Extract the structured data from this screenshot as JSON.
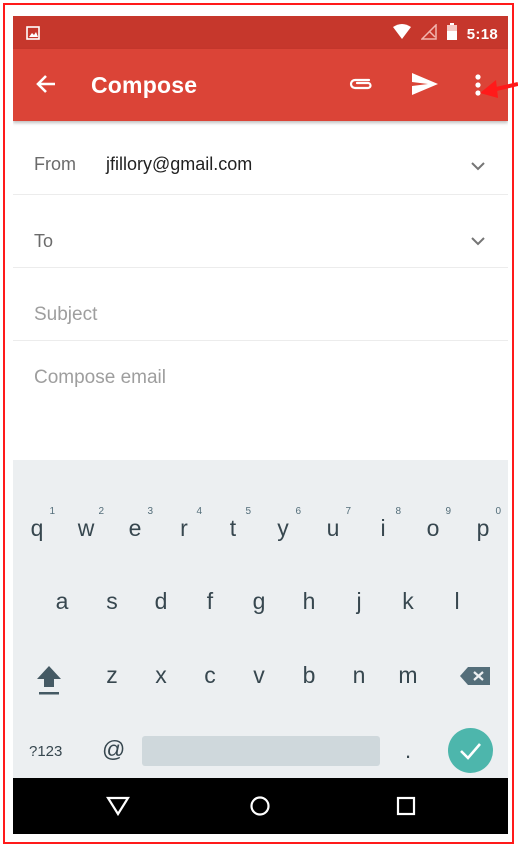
{
  "status_bar": {
    "time": "5:18"
  },
  "app_bar": {
    "title": "Compose"
  },
  "form": {
    "from_label": "From",
    "from_value": "jfillory@gmail.com",
    "to_label": "To",
    "subject_placeholder": "Subject",
    "body_placeholder": "Compose email"
  },
  "keyboard": {
    "row1": [
      {
        "k": "q",
        "n": "1"
      },
      {
        "k": "w",
        "n": "2"
      },
      {
        "k": "e",
        "n": "3"
      },
      {
        "k": "r",
        "n": "4"
      },
      {
        "k": "t",
        "n": "5"
      },
      {
        "k": "y",
        "n": "6"
      },
      {
        "k": "u",
        "n": "7"
      },
      {
        "k": "i",
        "n": "8"
      },
      {
        "k": "o",
        "n": "9"
      },
      {
        "k": "p",
        "n": "0"
      }
    ],
    "row2": [
      "a",
      "s",
      "d",
      "f",
      "g",
      "h",
      "j",
      "k",
      "l"
    ],
    "row3": [
      "z",
      "x",
      "c",
      "v",
      "b",
      "n",
      "m"
    ],
    "symbols_label": "?123",
    "at_label": "@",
    "period_label": "."
  },
  "colors": {
    "status_bar": "#c6372c",
    "app_bar": "#db4437",
    "keyboard_bg": "#eceff1",
    "enter_key": "#4db6ac",
    "annotation": "#ff1a1a"
  },
  "icons": [
    "image-notification-icon",
    "wifi-icon",
    "no-signal-icon",
    "battery-icon",
    "back-arrow-icon",
    "attachment-icon",
    "send-icon",
    "more-vert-icon",
    "chevron-down-icon",
    "shift-icon",
    "backspace-icon",
    "check-icon",
    "nav-back-icon",
    "nav-home-icon",
    "nav-recents-icon",
    "annotation-arrow-icon"
  ]
}
